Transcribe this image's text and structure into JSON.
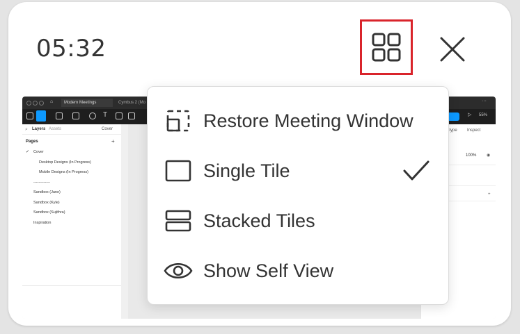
{
  "header": {
    "timer": "05:32"
  },
  "icons": {
    "layout": "grid-icon",
    "close": "close-icon",
    "restore": "restore-window-icon",
    "single": "single-tile-icon",
    "stacked": "stacked-tiles-icon",
    "self_view": "eye-icon",
    "selected": "checkmark-icon"
  },
  "colors": {
    "highlight_border": "#d9242b",
    "icon": "#333333",
    "accent": "#0d99ff"
  },
  "menu": {
    "items": [
      {
        "label": "Restore Meeting Window",
        "icon": "restore-window-icon",
        "selected": false
      },
      {
        "label": "Single Tile",
        "icon": "single-tile-icon",
        "selected": true
      },
      {
        "label": "Stacked Tiles",
        "icon": "stacked-tiles-icon",
        "selected": false
      },
      {
        "label": "Show Self View",
        "icon": "eye-icon",
        "selected": false
      }
    ]
  },
  "preview": {
    "tabs": [
      "Modern Meetings",
      "Cymbus 2 (Mo"
    ],
    "share_label": "Share",
    "zoom": "55%",
    "left_panel": {
      "tabs": [
        "Layers",
        "Assets"
      ],
      "page_selector": "Cover",
      "pages_title": "Pages",
      "pages": [
        "Cover",
        "Desktop Designs (In Progress)",
        "Mobile Designs (In Progress)",
        "-------------",
        "Sandbox (Jane)",
        "Sandbox (Kyle)",
        "Sandbox (Sujithra)",
        "Inspiration"
      ]
    },
    "right_panel": {
      "tabs": [
        "Prototype",
        "Inspect"
      ],
      "opacity": "100%"
    }
  }
}
